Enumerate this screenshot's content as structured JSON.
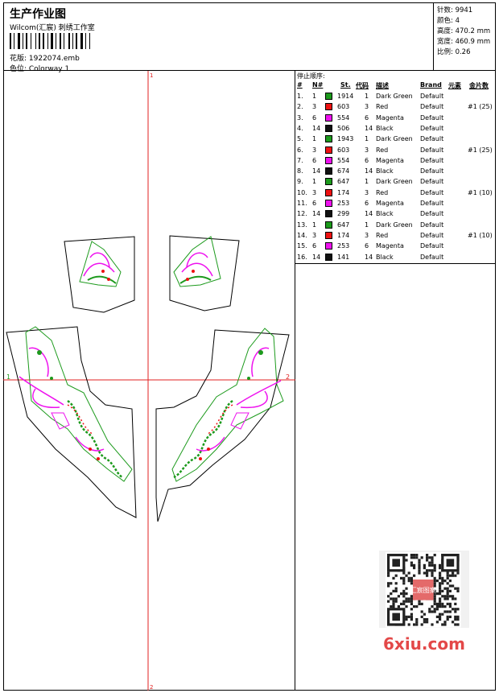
{
  "header": {
    "title": "生产作业图",
    "company": "Wilcom(汇宸) 刺绣工作室",
    "design_line": "花版:  1922074.emb",
    "colorway_line": "色位:  Colorway 1"
  },
  "stats": {
    "stitches": "针数: 9941",
    "colors": "颜色: 4",
    "height": "高度: 470.2 mm",
    "width": "宽度: 460.9 mm",
    "scale": "比例: 0.26"
  },
  "stop_sequence": {
    "title": "停止顺序:",
    "headers": [
      "#",
      "N#",
      "St.",
      "代码",
      "描述",
      "Brand",
      "元素",
      "金片数"
    ],
    "rows": [
      {
        "num": "1.",
        "n": "1",
        "color": "#1c9a1c",
        "st": "1914",
        "code": "1",
        "desc": "Dark Green",
        "brand": "Default",
        "seq": ""
      },
      {
        "num": "2.",
        "n": "3",
        "color": "#ee1111",
        "st": "603",
        "code": "3",
        "desc": "Red",
        "brand": "Default",
        "seq": "#1 (25)"
      },
      {
        "num": "3.",
        "n": "6",
        "color": "#ee11ee",
        "st": "554",
        "code": "6",
        "desc": "Magenta",
        "brand": "Default",
        "seq": ""
      },
      {
        "num": "4.",
        "n": "14",
        "color": "#111111",
        "st": "506",
        "code": "14",
        "desc": "Black",
        "brand": "Default",
        "seq": ""
      },
      {
        "num": "5.",
        "n": "1",
        "color": "#1c9a1c",
        "st": "1943",
        "code": "1",
        "desc": "Dark Green",
        "brand": "Default",
        "seq": ""
      },
      {
        "num": "6.",
        "n": "3",
        "color": "#ee1111",
        "st": "603",
        "code": "3",
        "desc": "Red",
        "brand": "Default",
        "seq": "#1 (25)"
      },
      {
        "num": "7.",
        "n": "6",
        "color": "#ee11ee",
        "st": "554",
        "code": "6",
        "desc": "Magenta",
        "brand": "Default",
        "seq": ""
      },
      {
        "num": "8.",
        "n": "14",
        "color": "#111111",
        "st": "674",
        "code": "14",
        "desc": "Black",
        "brand": "Default",
        "seq": ""
      },
      {
        "num": "9.",
        "n": "1",
        "color": "#1c9a1c",
        "st": "647",
        "code": "1",
        "desc": "Dark Green",
        "brand": "Default",
        "seq": ""
      },
      {
        "num": "10.",
        "n": "3",
        "color": "#ee1111",
        "st": "174",
        "code": "3",
        "desc": "Red",
        "brand": "Default",
        "seq": "#1 (10)"
      },
      {
        "num": "11.",
        "n": "6",
        "color": "#ee11ee",
        "st": "253",
        "code": "6",
        "desc": "Magenta",
        "brand": "Default",
        "seq": ""
      },
      {
        "num": "12.",
        "n": "14",
        "color": "#111111",
        "st": "299",
        "code": "14",
        "desc": "Black",
        "brand": "Default",
        "seq": ""
      },
      {
        "num": "13.",
        "n": "1",
        "color": "#1c9a1c",
        "st": "647",
        "code": "1",
        "desc": "Dark Green",
        "brand": "Default",
        "seq": ""
      },
      {
        "num": "14.",
        "n": "3",
        "color": "#ee1111",
        "st": "174",
        "code": "3",
        "desc": "Red",
        "brand": "Default",
        "seq": "#1 (10)"
      },
      {
        "num": "15.",
        "n": "6",
        "color": "#ee11ee",
        "st": "253",
        "code": "6",
        "desc": "Magenta",
        "brand": "Default",
        "seq": ""
      },
      {
        "num": "16.",
        "n": "14",
        "color": "#111111",
        "st": "141",
        "code": "14",
        "desc": "Black",
        "brand": "Default",
        "seq": ""
      }
    ]
  },
  "canvas": {
    "marker_left": "1",
    "marker_right": "2",
    "marker_top": "1",
    "marker_bottom": "2",
    "guide_color": "#e02020"
  },
  "watermark": {
    "text": "6xiu.com",
    "stamp": "汇宸图案"
  }
}
